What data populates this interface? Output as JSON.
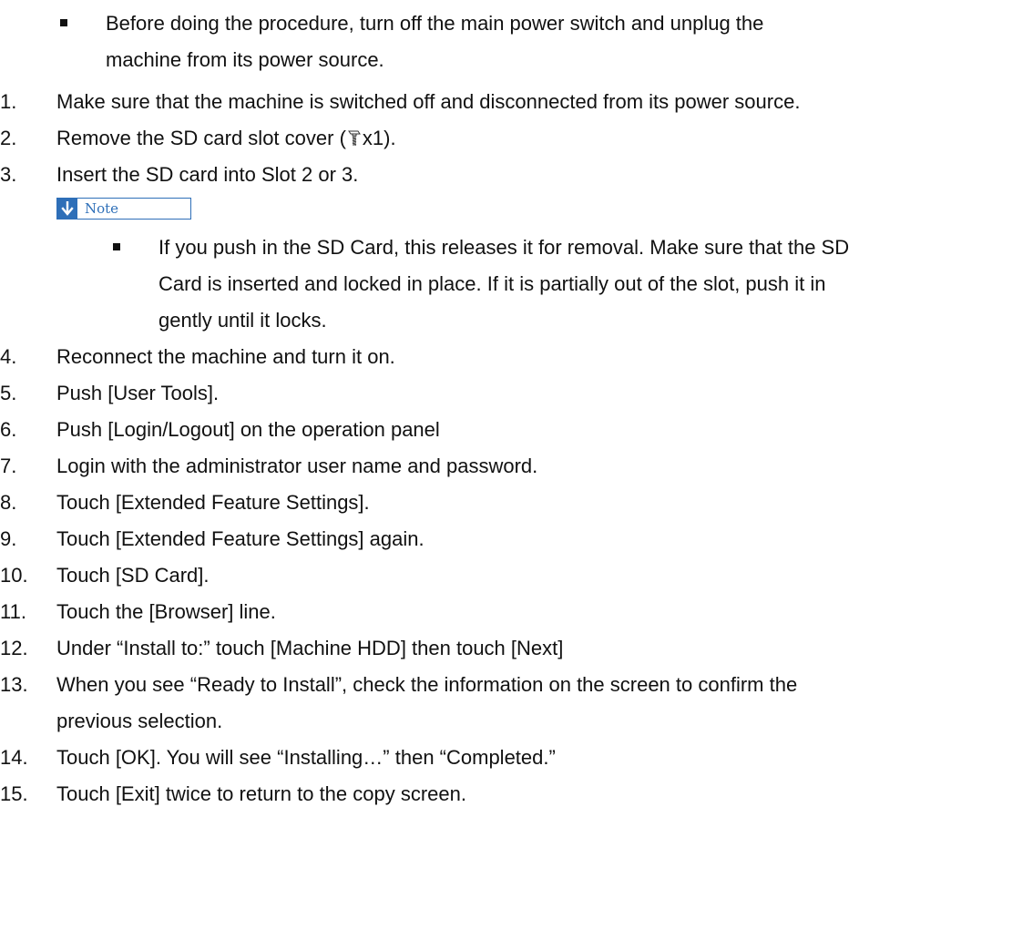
{
  "top_bullet": "Before doing the procedure, turn off the main power switch and unplug the machine from its power source.",
  "top_bullet_line1": "Before doing the procedure, turn off the main power switch and unplug the",
  "top_bullet_line2": "machine from its power source.",
  "steps": [
    {
      "num": "1.",
      "text": "Make sure that the machine is switched off and disconnected from its power source."
    },
    {
      "num": "2.",
      "text_before": "Remove the SD card slot cover (",
      "icon": "screw-icon",
      "text_after": "x1)."
    },
    {
      "num": "3.",
      "text": "Insert the SD card into Slot 2 or 3."
    },
    {
      "num": "4.",
      "text": "Reconnect the machine and turn it on."
    },
    {
      "num": "5.",
      "text": "Push [User Tools]."
    },
    {
      "num": "6.",
      "text": "Push [Login/Logout] on the operation panel"
    },
    {
      "num": "7.",
      "text": "Login with the administrator user name and password."
    },
    {
      "num": "8.",
      "text": "Touch [Extended Feature Settings]."
    },
    {
      "num": "9.",
      "text": "Touch [Extended Feature Settings] again."
    },
    {
      "num": "10.",
      "text": "Touch [SD Card]."
    },
    {
      "num": "11.",
      "text": "Touch the [Browser] line."
    },
    {
      "num": "12.",
      "text": "Under “Install to:” touch [Machine HDD] then touch [Next]"
    },
    {
      "num": "13.",
      "line1": "When you see “Ready to Install”, check the information on the screen to confirm the",
      "line2": "previous selection."
    },
    {
      "num": "14.",
      "text": "Touch [OK]. You will see “Installing…” then “Completed.”"
    },
    {
      "num": "15.",
      "text": "Touch [Exit] twice to return to the copy screen."
    }
  ],
  "note": {
    "label": "Note",
    "icon": "down-arrow-icon",
    "color": "#2e6fb8",
    "line1": "If you push in the SD Card, this releases it for removal. Make sure that the SD",
    "line2": "Card is inserted and locked in place. If it is partially out of the slot, push it in",
    "line3": "gently until it locks."
  }
}
